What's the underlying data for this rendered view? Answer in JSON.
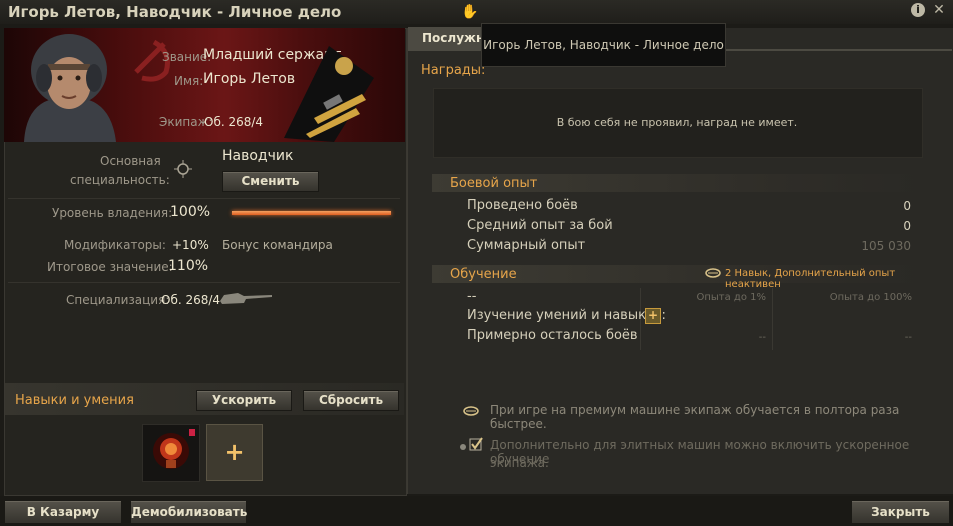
{
  "window": {
    "title": "Игорь Летов, Наводчик - Личное дело",
    "tooltip": "Игорь Летов, Наводчик - Личное дело"
  },
  "profile": {
    "rank_label": "Звание:",
    "rank_value": "Младший сержант",
    "name_label": "Имя:",
    "name_value": "Игорь Летов",
    "crew_label": "Экипаж:",
    "crew_value": "Об. 268/4"
  },
  "specialty": {
    "label_line1": "Основная",
    "label_line2": "специальность:",
    "value": "Наводчик",
    "change_button": "Сменить"
  },
  "stats": {
    "mastery_label": "Уровень владения:",
    "mastery_value": "100%",
    "mastery_fraction": 1.0,
    "modifiers_label": "Модификаторы:",
    "modifiers_value": "+10%",
    "modifiers_note": "Бонус командира",
    "total_label": "Итоговое значение:",
    "total_value": "110%",
    "specialization_label": "Специализация:",
    "specialization_value": "Об. 268/4"
  },
  "skills": {
    "title": "Навыки и умения",
    "speedup_button": "Ускорить",
    "reset_button": "Сбросить",
    "add_symbol": "+"
  },
  "tabs": {
    "service": "Послужно"
  },
  "awards": {
    "title": "Награды:",
    "empty_text": "В бою себя не проявил, наград не имеет."
  },
  "combat": {
    "title": "Боевой опыт",
    "rows": [
      {
        "label": "Проведено боёв",
        "value": "0"
      },
      {
        "label": "Средний опыт за бой",
        "value": "0"
      },
      {
        "label": "Суммарный опыт",
        "value": "105 030"
      }
    ]
  },
  "training": {
    "title": "Обучение",
    "status": "2 Навык, Дополнительный опыт неактивен",
    "col1_header": "Опыта до 1%",
    "col2_header": "Опыта до 100%",
    "row0_label": "--",
    "row1_label": "Изучение умений и навыков:",
    "row2_label": "Примерно осталось боёв",
    "row2_val1": "--",
    "row2_val2": "--",
    "add_symbol": "+"
  },
  "notes": {
    "premium": "При игре на премиум машине экипаж обучается в полтора раза быстрее.",
    "elite_line1": "Дополнительно для элитных машин можно включить ускоренное обучение",
    "elite_line2": "экипажа."
  },
  "footer": {
    "barracks_button": "В Казарму",
    "demobilize_button": "Демобилизовать",
    "close_button": "Закрыть"
  },
  "colors": {
    "accent_orange": "#e7a54a",
    "portrait_red": "#6b1616"
  },
  "icons": [
    "info-icon",
    "close-icon",
    "target-icon",
    "tank-icon",
    "lightbulb-icon",
    "plus-icon",
    "training-book-icon",
    "checkbox-icon",
    "cursor-icon"
  ]
}
